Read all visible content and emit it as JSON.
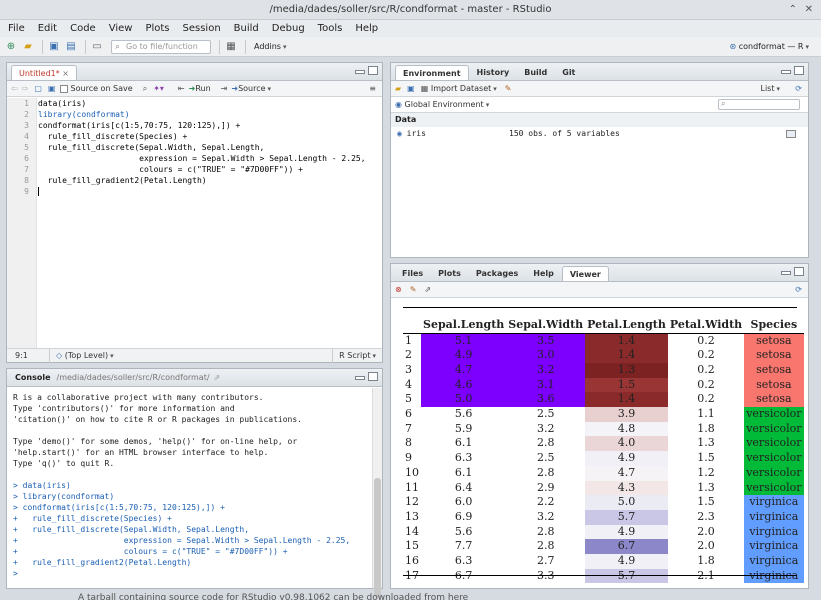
{
  "window": {
    "title": "/media/dades/soller/src/R/condformat - master - RStudio",
    "controls": [
      "⌃",
      "✕"
    ]
  },
  "menu": [
    "File",
    "Edit",
    "Code",
    "View",
    "Plots",
    "Session",
    "Build",
    "Debug",
    "Tools",
    "Help"
  ],
  "toolbar": {
    "goto_placeholder": "Go to file/function",
    "addins": "Addins",
    "project": "condformat — R"
  },
  "editor": {
    "tab": "Untitled1*",
    "source_on_save": "Source on Save",
    "run": "Run",
    "source": "Source",
    "lines": [
      "data(iris)",
      "library(condformat)",
      "condformat(iris[c(1:5,70:75, 120:125),]) +",
      "  rule_fill_discrete(Species) +",
      "  rule_fill_discrete(Sepal.Width, Sepal.Length,",
      "                     expression = Sepal.Width > Sepal.Length - 2.25,",
      "                     colours = c(\"TRUE\" = \"#7D00FF\")) +",
      "  rule_fill_gradient2(Petal.Length)",
      ""
    ],
    "status_pos": "9:1",
    "status_scope": "(Top Level)",
    "status_type": "R Script"
  },
  "console": {
    "title": "Console",
    "path": "/media/dades/soller/src/R/condformat/",
    "text_lines": [
      "R is a collaborative project with many contributors.",
      "Type 'contributors()' for more information and",
      "'citation()' on how to cite R or R packages in publications.",
      "",
      "Type 'demo()' for some demos, 'help()' for on-line help, or",
      "'help.start()' for an HTML browser interface to help.",
      "Type 'q()' to quit R.",
      ""
    ],
    "input_lines": [
      "> data(iris)",
      "> library(condformat)",
      "> condformat(iris[c(1:5,70:75, 120:125),]) +",
      "+   rule_fill_discrete(Species) +",
      "+   rule_fill_discrete(Sepal.Width, Sepal.Length,",
      "+                      expression = Sepal.Width > Sepal.Length - 2.25,",
      "+                      colours = c(\"TRUE\" = \"#7D00FF\")) +",
      "+   rule_fill_gradient2(Petal.Length)",
      "> "
    ]
  },
  "env": {
    "tabs": [
      "Environment",
      "History",
      "Build",
      "Git"
    ],
    "import": "Import Dataset",
    "list": "List",
    "scope": "Global Environment",
    "section": "Data",
    "row_name": "iris",
    "row_value": "150 obs. of 5 variables"
  },
  "viewer": {
    "tabs": [
      "Files",
      "Plots",
      "Packages",
      "Help",
      "Viewer"
    ],
    "headers": [
      "",
      "Sepal.Length",
      "Sepal.Width",
      "Petal.Length",
      "Petal.Width",
      "Species"
    ],
    "rows": [
      [
        "1",
        "5.1",
        "3.5",
        "1.4",
        "0.2",
        "setosa"
      ],
      [
        "2",
        "4.9",
        "3.0",
        "1.4",
        "0.2",
        "setosa"
      ],
      [
        "3",
        "4.7",
        "3.2",
        "1.3",
        "0.2",
        "setosa"
      ],
      [
        "4",
        "4.6",
        "3.1",
        "1.5",
        "0.2",
        "setosa"
      ],
      [
        "5",
        "5.0",
        "3.6",
        "1.4",
        "0.2",
        "setosa"
      ],
      [
        "6",
        "5.6",
        "2.5",
        "3.9",
        "1.1",
        "versicolor"
      ],
      [
        "7",
        "5.9",
        "3.2",
        "4.8",
        "1.8",
        "versicolor"
      ],
      [
        "8",
        "6.1",
        "2.8",
        "4.0",
        "1.3",
        "versicolor"
      ],
      [
        "9",
        "6.3",
        "2.5",
        "4.9",
        "1.5",
        "versicolor"
      ],
      [
        "10",
        "6.1",
        "2.8",
        "4.7",
        "1.2",
        "versicolor"
      ],
      [
        "11",
        "6.4",
        "2.9",
        "4.3",
        "1.3",
        "versicolor"
      ],
      [
        "12",
        "6.0",
        "2.2",
        "5.0",
        "1.5",
        "virginica"
      ],
      [
        "13",
        "6.9",
        "3.2",
        "5.7",
        "2.3",
        "virginica"
      ],
      [
        "14",
        "5.6",
        "2.8",
        "4.9",
        "2.0",
        "virginica"
      ],
      [
        "15",
        "7.7",
        "2.8",
        "6.7",
        "2.0",
        "virginica"
      ],
      [
        "16",
        "6.3",
        "2.7",
        "4.9",
        "1.8",
        "virginica"
      ],
      [
        "17",
        "6.7",
        "3.3",
        "5.7",
        "2.1",
        "virginica"
      ]
    ],
    "colors": {
      "sepal_true": "#7d00ff",
      "setosa": "#f8766d",
      "versicolor": "#00ba38",
      "virginica": "#619cff",
      "petal": [
        "#8b2a2a",
        "#8b2a2a",
        "#7d2222",
        "#9a3535",
        "#8b2a2a",
        "#e8d0d0",
        "#f4f4f8",
        "#ead6d6",
        "#f0f0f6",
        "#f5f3f6",
        "#f2e6e6",
        "#ebebf4",
        "#c9c6e6",
        "#f0f0f6",
        "#8c87c8",
        "#f0f0f6",
        "#c9c6e6"
      ]
    }
  },
  "footer_text": "A tarball containing source code for RStudio v0.98.1062 can be downloaded from here"
}
